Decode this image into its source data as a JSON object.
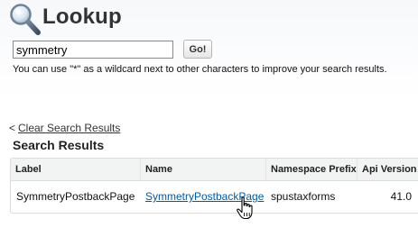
{
  "header": {
    "title": "Lookup",
    "icon": "magnifier-icon"
  },
  "search": {
    "value": "symmetry",
    "go_label": "Go!",
    "hint": "You can use \"*\" as a wildcard next to other characters to improve your search results."
  },
  "results": {
    "back_prefix": "<",
    "clear_link": "Clear Search Results",
    "title": "Search Results",
    "columns": [
      "Label",
      "Name",
      "Namespace Prefix",
      "Api Version"
    ],
    "rows": [
      {
        "label": "SymmetryPostbackPage",
        "name": "SymmetryPostbackPage",
        "namespace_prefix": "spustaxforms",
        "api_version": "41.0"
      }
    ]
  },
  "colors": {
    "link": "#015ba7",
    "header_bg": "#f2f3f3",
    "border": "#dcdcdc"
  },
  "cursor": "hand-pointer-icon"
}
